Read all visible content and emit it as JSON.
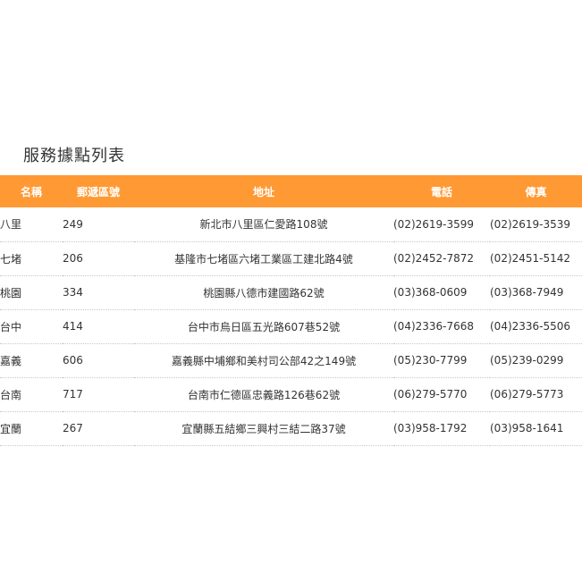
{
  "page_title": "服務據點列表",
  "table": {
    "headers": {
      "name": "名稱",
      "zip": "郵遞區號",
      "address": "地址",
      "phone": "電話",
      "fax": "傳真"
    },
    "rows": [
      {
        "name": "八里",
        "zip": "249",
        "address": "新北市八里區仁愛路108號",
        "phone": "(02)2619-3599",
        "fax": "(02)2619-3539"
      },
      {
        "name": "七堵",
        "zip": "206",
        "address": "基隆市七堵區六堵工業區工建北路4號",
        "phone": "(02)2452-7872",
        "fax": "(02)2451-5142"
      },
      {
        "name": "桃園",
        "zip": "334",
        "address": "桃園縣八德市建國路62號",
        "phone": "(03)368-0609",
        "fax": "(03)368-7949"
      },
      {
        "name": "台中",
        "zip": "414",
        "address": "台中市烏日區五光路607巷52號",
        "phone": "(04)2336-7668",
        "fax": "(04)2336-5506"
      },
      {
        "name": "嘉義",
        "zip": "606",
        "address": "嘉義縣中埔鄉和美村司公部42之149號",
        "phone": "(05)230-7799",
        "fax": "(05)239-0299"
      },
      {
        "name": "台南",
        "zip": "717",
        "address": "台南市仁德區忠義路126巷62號",
        "phone": "(06)279-5770",
        "fax": "(06)279-5773"
      },
      {
        "name": "宜蘭",
        "zip": "267",
        "address": "宜蘭縣五結鄉三興村三結二路37號",
        "phone": "(03)958-1792",
        "fax": "(03)958-1641"
      }
    ]
  },
  "colors": {
    "header_background": "#ff9933",
    "header_text": "#ffffff",
    "body_text": "#333333"
  }
}
